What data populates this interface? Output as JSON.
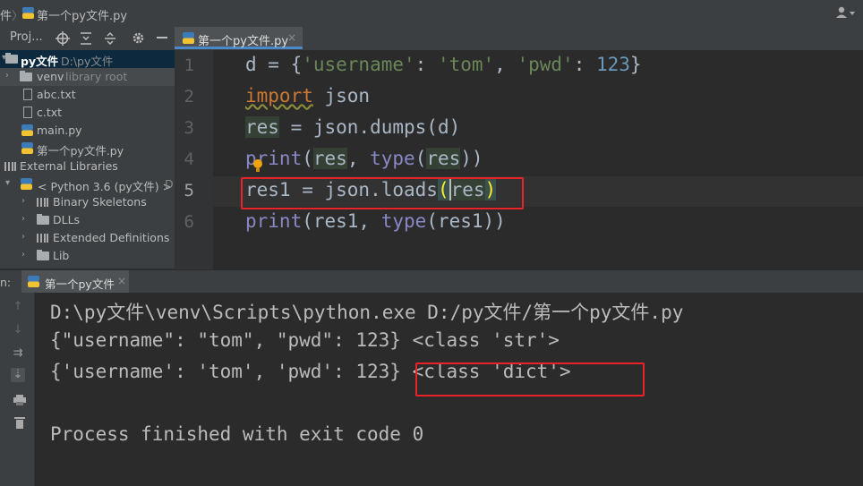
{
  "breadcrumb": {
    "part1": "件",
    "sep": "〉",
    "file": "第一个py文件.py"
  },
  "user_icon": "user-icon",
  "project_toolbar": {
    "label": "Proj...",
    "icons": [
      "crosshair-icon",
      "collapse-all-icon",
      "expand-all-icon",
      "gear-icon",
      "minimize-icon"
    ]
  },
  "editor_tab": {
    "label": "第一个py文件.py",
    "close": "×"
  },
  "tree": [
    {
      "label": "py文件",
      "path": "D:\\py文件"
    },
    {
      "label": "venv",
      "note": "library root"
    },
    {
      "label": "abc.txt"
    },
    {
      "label": "c.txt"
    },
    {
      "label": "main.py"
    },
    {
      "label": "第一个py文件.py"
    },
    {
      "label": "External Libraries"
    },
    {
      "label": "< Python 3.6 (py文件) >",
      "note": "D:"
    },
    {
      "label": "Binary Skeletons"
    },
    {
      "label": "DLLs"
    },
    {
      "label": "Extended Definitions"
    },
    {
      "label": "Lib"
    }
  ],
  "line_numbers": [
    "1",
    "2",
    "3",
    "4",
    "5",
    "6"
  ],
  "code": {
    "l1": {
      "a": "d = {",
      "b": "'username'",
      "c": ": ",
      "d": "'tom'",
      "e": ", ",
      "f": "'pwd'",
      "g": ": ",
      "h": "123",
      "i": "}"
    },
    "l2": {
      "a": "import",
      "b": " json"
    },
    "l3": {
      "a": "res",
      "b": " = json.dumps(d)"
    },
    "l4": {
      "a": "print",
      "b": "(",
      "c": "res",
      "d": ", ",
      "e": "type",
      "f": "(",
      "g": "res",
      "h": "))"
    },
    "l5": {
      "a": "res1 = json.loads",
      "b": "(",
      "c": "res",
      "d": ")"
    },
    "l6": {
      "a": "print",
      "b": "(res1, ",
      "c": "type",
      "d": "(res1))"
    }
  },
  "run_tab": {
    "prefix": "n:",
    "label": "第一个py文件",
    "close": "×"
  },
  "console": {
    "cmd": "D:\\py文件\\venv\\Scripts\\python.exe D:/py文件/第一个py文件.py",
    "out1": "{\"username\": \"tom\", \"pwd\": 123} <class 'str'>",
    "out2": "{'username': 'tom', 'pwd': 123} <class 'dict'>",
    "exit": "Process finished with exit code 0"
  },
  "colors": {
    "annotation": "#e8232a",
    "keyword": "#cc7832",
    "string": "#6a8759",
    "number": "#6897bb",
    "builtin": "#8888c6"
  }
}
